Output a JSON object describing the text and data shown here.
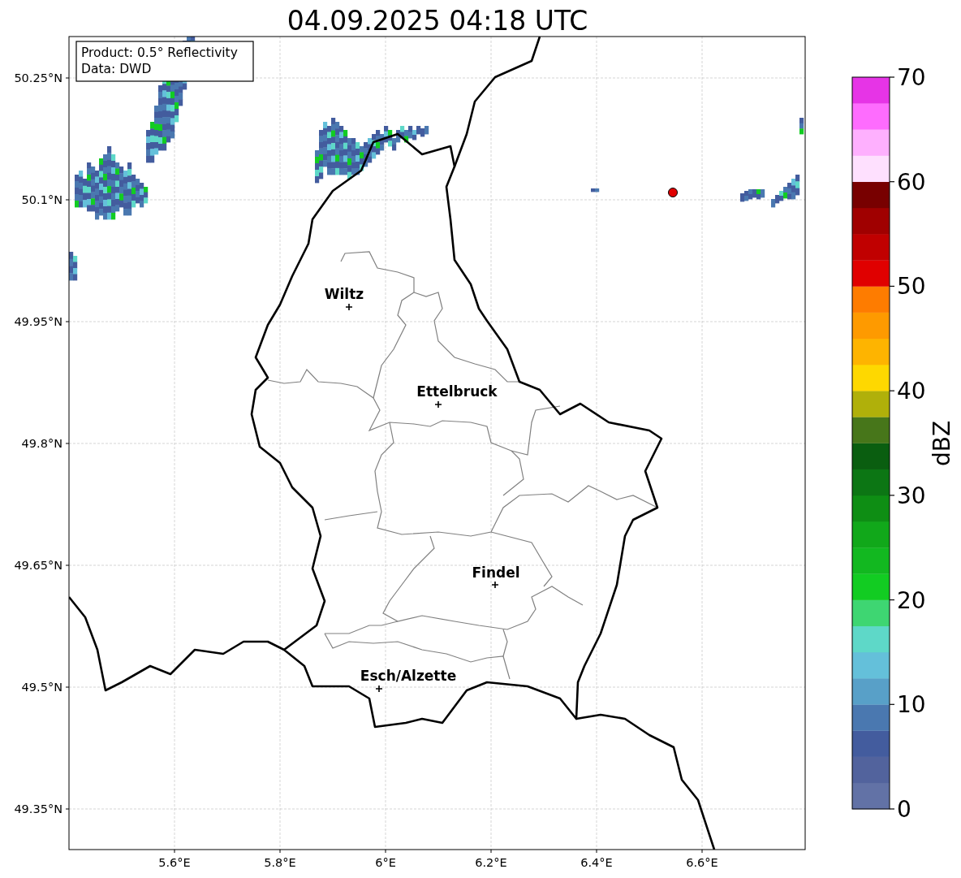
{
  "title": "04.09.2025 04:18 UTC",
  "info_box": [
    "Product: 0.5° Reflectivity",
    "Data: DWD"
  ],
  "y_ticks": [
    "50.25°N",
    "50.1°N",
    "49.95°N",
    "49.8°N",
    "49.65°N",
    "49.5°N",
    "49.35°N"
  ],
  "x_ticks": [
    "5.6°E",
    "5.8°E",
    "6°E",
    "6.2°E",
    "6.4°E",
    "6.6°E"
  ],
  "cities": [
    {
      "name": "Wiltz"
    },
    {
      "name": "Ettelbruck"
    },
    {
      "name": "Findel"
    },
    {
      "name": "Esch/Alzette"
    }
  ],
  "colorbar": {
    "label": "dBZ",
    "ticks": [
      "70",
      "60",
      "50",
      "40",
      "30",
      "20",
      "10",
      "0"
    ],
    "segments": [
      {
        "color": "#6272a6"
      },
      {
        "color": "#52639d"
      },
      {
        "color": "#435c9e"
      },
      {
        "color": "#4a78b0"
      },
      {
        "color": "#58a0c8"
      },
      {
        "color": "#64c0da"
      },
      {
        "color": "#5ed8c8"
      },
      {
        "color": "#3ed672"
      },
      {
        "color": "#12cc22"
      },
      {
        "color": "#12b820"
      },
      {
        "color": "#11a81a"
      },
      {
        "color": "#0e8e14"
      },
      {
        "color": "#0c7614"
      },
      {
        "color": "#0a5e10"
      },
      {
        "color": "#47761a"
      },
      {
        "color": "#b0b00a"
      },
      {
        "color": "#fed800"
      },
      {
        "color": "#feb400"
      },
      {
        "color": "#fe9a00"
      },
      {
        "color": "#fe7c00"
      },
      {
        "color": "#e00000"
      },
      {
        "color": "#c00000"
      },
      {
        "color": "#a00000"
      },
      {
        "color": "#780000"
      },
      {
        "color": "#fee0fe"
      },
      {
        "color": "#feb0fe"
      },
      {
        "color": "#fe6cfe"
      },
      {
        "color": "#e634e6"
      }
    ]
  }
}
